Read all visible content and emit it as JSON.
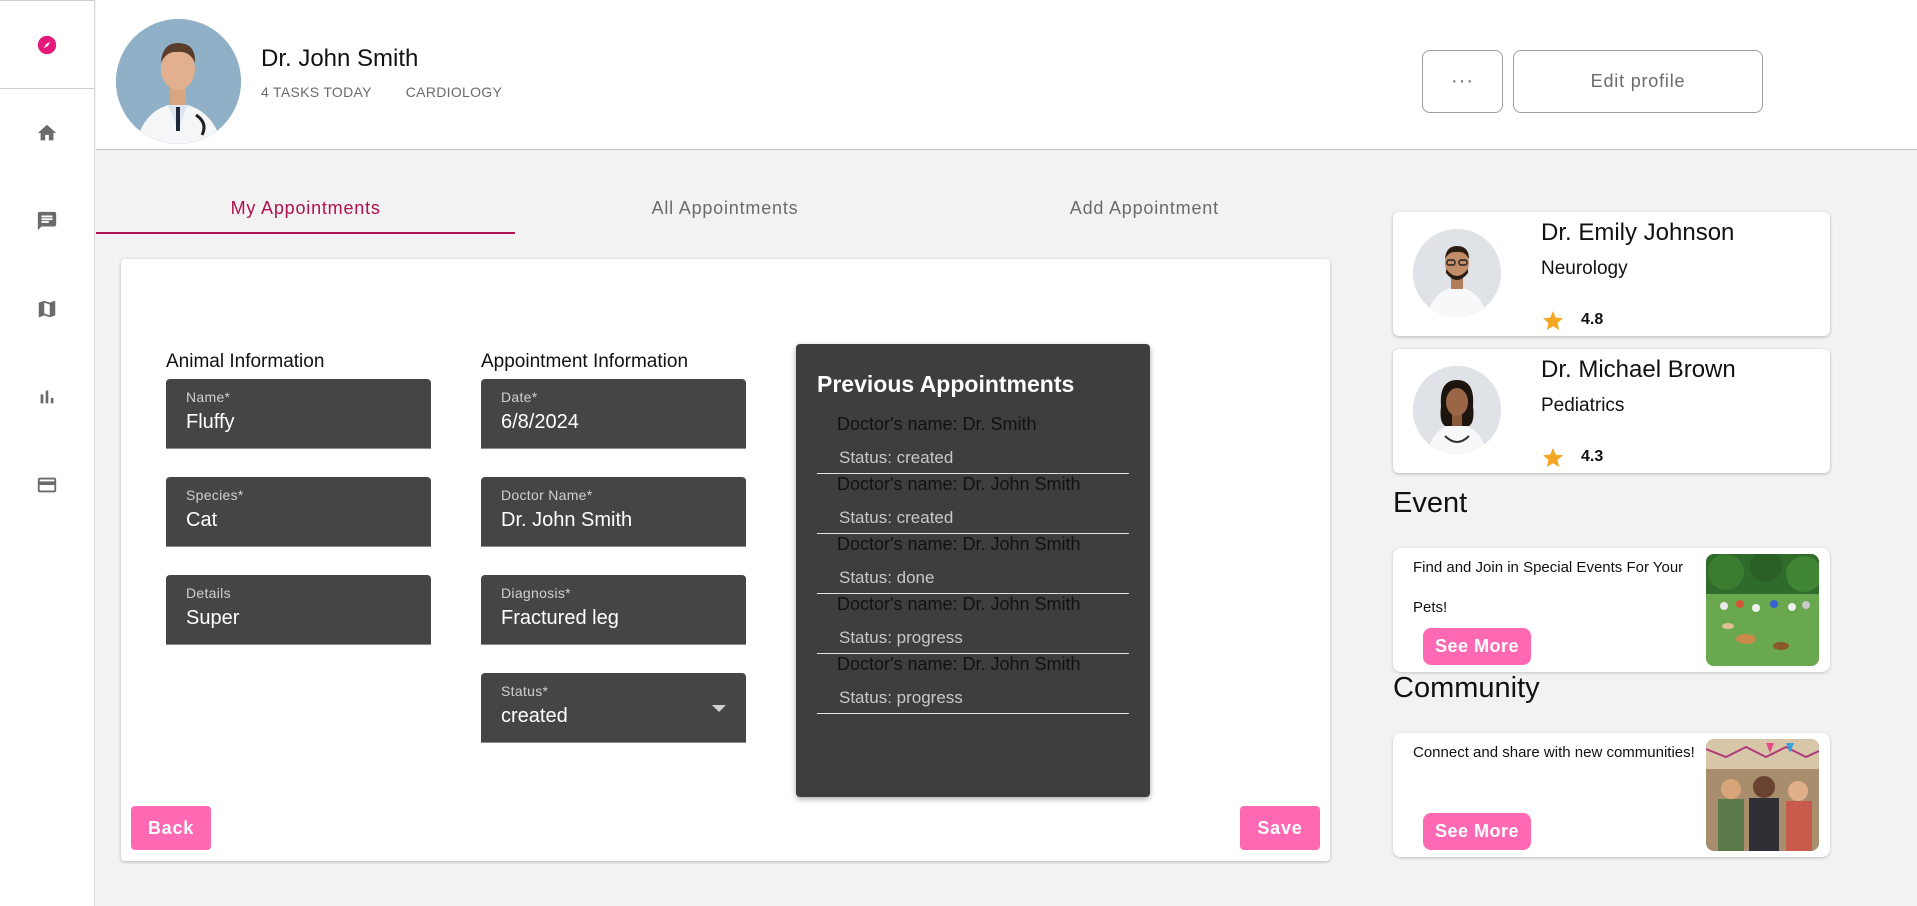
{
  "sidebar": {
    "items": [
      {
        "icon": "compass-icon",
        "active": true
      },
      {
        "icon": "home-icon"
      },
      {
        "icon": "chat-icon"
      },
      {
        "icon": "map-icon"
      },
      {
        "icon": "bar-chart-icon"
      },
      {
        "icon": "credit-card-icon"
      }
    ]
  },
  "header": {
    "name": "Dr. John Smith",
    "tasks": "4 TASKS TODAY",
    "department": "CARDIOLOGY",
    "more_label": "···",
    "edit_label": "Edit profile"
  },
  "tabs": [
    {
      "label": "My Appointments",
      "active": true
    },
    {
      "label": "All Appointments"
    },
    {
      "label": "Add Appointment"
    }
  ],
  "form": {
    "animal_title": "Animal Information",
    "appointment_title": "Appointment Information",
    "animal_fields": [
      {
        "label": "Name*",
        "value": "Fluffy"
      },
      {
        "label": "Species*",
        "value": "Cat"
      },
      {
        "label": "Details",
        "value": "Super"
      }
    ],
    "appointment_fields": [
      {
        "label": "Date*",
        "value": "6/8/2024"
      },
      {
        "label": "Doctor Name*",
        "value": "Dr. John Smith"
      },
      {
        "label": "Diagnosis*",
        "value": "Fractured leg"
      },
      {
        "label": "Status*",
        "value": "created"
      }
    ],
    "back_label": "Back",
    "save_label": "Save"
  },
  "previous": {
    "title": "Previous Appointments",
    "items": [
      {
        "doctor": "Doctor's name: Dr. Smith",
        "status": "Status: created"
      },
      {
        "doctor": "Doctor's name: Dr. John Smith",
        "status": "Status: created"
      },
      {
        "doctor": "Doctor's name: Dr. John Smith",
        "status": "Status: done"
      },
      {
        "doctor": "Doctor's name: Dr. John Smith",
        "status": "Status: progress"
      },
      {
        "doctor": "Doctor's name: Dr. John Smith",
        "status": "Status: progress"
      }
    ]
  },
  "doctors": [
    {
      "name": "Dr. Emily Johnson",
      "specialty": "Neurology",
      "rating": "4.8"
    },
    {
      "name": "Dr. Michael Brown",
      "specialty": "Pediatrics",
      "rating": "4.3"
    }
  ],
  "event": {
    "heading": "Event",
    "text": "Find and Join in Special Events For Your Pets!",
    "button": "See More"
  },
  "community": {
    "heading": "Community",
    "text": "Connect and share with new communities!",
    "button": "See More"
  },
  "colors": {
    "accent": "#b0104f",
    "pink_button": "#ff69b4",
    "field_bg": "#454545",
    "panel_bg": "#3e3e3e",
    "star": "#f5a623"
  }
}
